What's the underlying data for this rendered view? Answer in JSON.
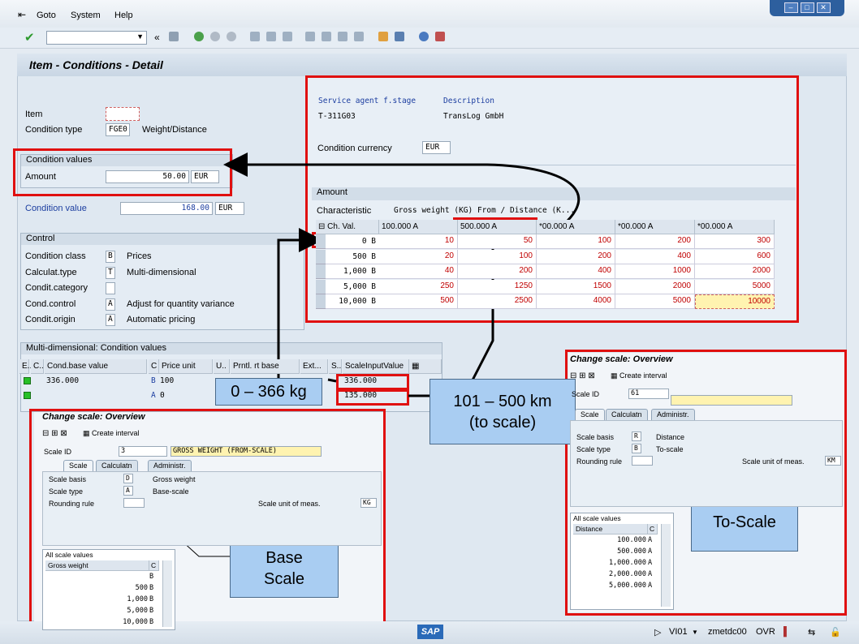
{
  "menu": {
    "goto": "Goto",
    "system": "System",
    "help": "Help"
  },
  "screen_title": "Item - Conditions - Detail",
  "item": {
    "item_label": "Item",
    "ctype_label": "Condition type",
    "ctype_value": "FGE0",
    "ctype_desc": "Weight/Distance"
  },
  "cond_values": {
    "header": "Condition values",
    "amount_label": "Amount",
    "amount_value": "50.00",
    "amount_cur": "EUR",
    "cvalue_label": "Condition value",
    "cvalue_value": "168.00",
    "cvalue_cur": "EUR"
  },
  "control": {
    "header": "Control",
    "rows": [
      {
        "label": "Condition class",
        "code": "B",
        "desc": "Prices"
      },
      {
        "label": "Calculat.type",
        "code": "T",
        "desc": "Multi-dimensional"
      },
      {
        "label": "Condit.category",
        "code": "",
        "desc": ""
      },
      {
        "label": "Cond.control",
        "code": "A",
        "desc": "Adjust for quantity variance"
      },
      {
        "label": "Condit.origin",
        "code": "A",
        "desc": "Automatic pricing"
      }
    ]
  },
  "multidim": {
    "header": "Multi-dimensional: Condition values",
    "cols": [
      "E..",
      "C..",
      "Cond.base value",
      "C",
      "Price unit",
      "U..",
      "Prntl. rt base",
      "Ext...",
      "S..",
      "ScaleInputValue"
    ],
    "rows": [
      {
        "base": "336.000",
        "c": "B",
        "unit": "100",
        "scale_input": "336.000"
      },
      {
        "base": "",
        "c": "A",
        "unit": "0",
        "scale_input": "135.000"
      }
    ]
  },
  "service": {
    "agent_label": "Service agent f.stage",
    "desc_label": "Description",
    "agent_value": "T-311G03",
    "desc_value": "TransLog GmbH",
    "currency_label": "Condition currency",
    "currency_value": "EUR"
  },
  "amount_table": {
    "header": "Amount",
    "char_label": "Characteristic",
    "char_value": "Gross weight (KG) From / Distance (K...",
    "first_col": "Ch. Val.",
    "col_heads": [
      "100.000 A",
      "500.000 A",
      "*00.000 A",
      "*00.000 A",
      "*00.000 A"
    ],
    "rows": [
      {
        "label": "0",
        "u": "B",
        "vals": [
          "10",
          "50",
          "100",
          "200",
          "300"
        ]
      },
      {
        "label": "500",
        "u": "B",
        "vals": [
          "20",
          "100",
          "200",
          "400",
          "600"
        ]
      },
      {
        "label": "1,000",
        "u": "B",
        "vals": [
          "40",
          "200",
          "400",
          "1000",
          "2000"
        ]
      },
      {
        "label": "5,000",
        "u": "B",
        "vals": [
          "250",
          "1250",
          "1500",
          "2000",
          "5000"
        ]
      },
      {
        "label": "10,000",
        "u": "B",
        "vals": [
          "500",
          "2500",
          "4000",
          "5000",
          "10000"
        ]
      }
    ]
  },
  "base_scale": {
    "title": "Change scale: Overview",
    "create": "Create interval",
    "scale_id_label": "Scale ID",
    "scale_id": "3",
    "scale_text": "GROSS WEIGHT (FROM-SCALE)",
    "tabs": [
      "Scale",
      "Calculatn",
      "Administr."
    ],
    "basis_label": "Scale basis",
    "basis_code": "D",
    "basis_desc": "Gross weight",
    "type_label": "Scale type",
    "type_code": "A",
    "type_desc": "Base-scale",
    "rounding_label": "Rounding rule",
    "uom_label": "Scale unit of meas.",
    "uom_value": "KG",
    "list_header": "All scale values",
    "list_col": "Gross weight",
    "list_col2": "C",
    "values": [
      {
        "v": "",
        "u": "B"
      },
      {
        "v": "500",
        "u": "B"
      },
      {
        "v": "1,000",
        "u": "B"
      },
      {
        "v": "5,000",
        "u": "B"
      },
      {
        "v": "10,000",
        "u": "B"
      }
    ]
  },
  "to_scale": {
    "title": "Change scale: Overview",
    "create": "Create interval",
    "scale_id_label": "Scale ID",
    "scale_id": "61",
    "tabs": [
      "Scale",
      "Calculatn",
      "Administr."
    ],
    "basis_label": "Scale basis",
    "basis_code": "R",
    "basis_desc": "Distance",
    "type_label": "Scale type",
    "type_code": "B",
    "type_desc": "To-scale",
    "rounding_label": "Rounding rule",
    "uom_label": "Scale unit of meas.",
    "uom_value": "KM",
    "list_header": "All scale values",
    "list_col": "Distance",
    "list_col2": "C",
    "values": [
      {
        "v": "100.000",
        "u": "A"
      },
      {
        "v": "500.000",
        "u": "A"
      },
      {
        "v": "1,000.000",
        "u": "A"
      },
      {
        "v": "2,000.000",
        "u": "A"
      },
      {
        "v": "5,000.000",
        "u": "A"
      }
    ]
  },
  "callouts": {
    "weight": "0 – 366 kg",
    "distance_1": "101 – 500 km",
    "distance_2": "(to scale)",
    "base_1": "Base",
    "base_2": "Scale",
    "to_scale": "To-Scale"
  },
  "status": {
    "tx": "VI01",
    "server": "zmetdc00",
    "mode": "OVR"
  },
  "colors": {
    "highlight": "#e01010",
    "callout": "#a9cdf2",
    "value_red": "#c00000",
    "input_yellow": "#fff3b0"
  }
}
